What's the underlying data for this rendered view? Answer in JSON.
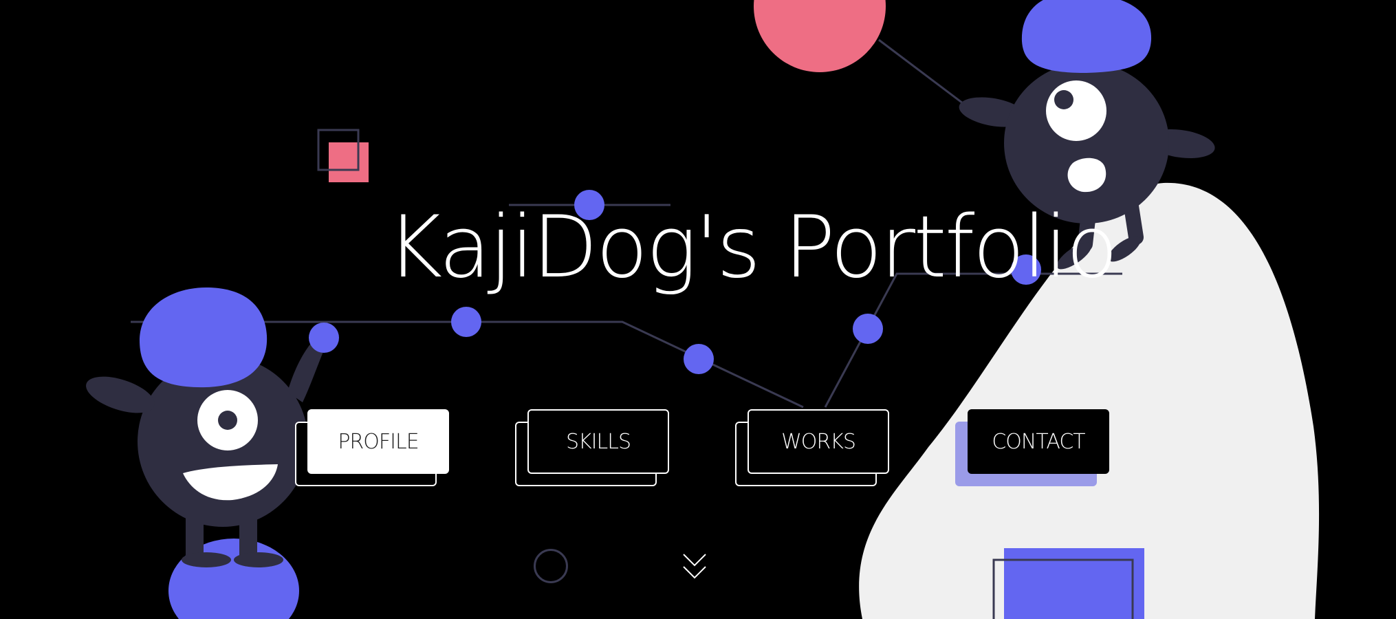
{
  "page": {
    "title": "KajiDog's Portfolio"
  },
  "nav": {
    "items": [
      {
        "label": "PROFILE",
        "active": true
      },
      {
        "label": "SKILLS",
        "active": false
      },
      {
        "label": "WORKS",
        "active": false
      },
      {
        "label": "CONTACT",
        "active": false
      }
    ]
  },
  "icons": {
    "scroll_indicator": "circle-outline-icon",
    "scroll_down": "double-chevron-down-icon"
  },
  "colors": {
    "background": "#000000",
    "accent_blue": "#6366f1",
    "accent_pink": "#ee6e84",
    "monster_body": "#2f2e41",
    "light_surface": "#f0f0f0",
    "contact_shadow": "#9a9be8"
  }
}
